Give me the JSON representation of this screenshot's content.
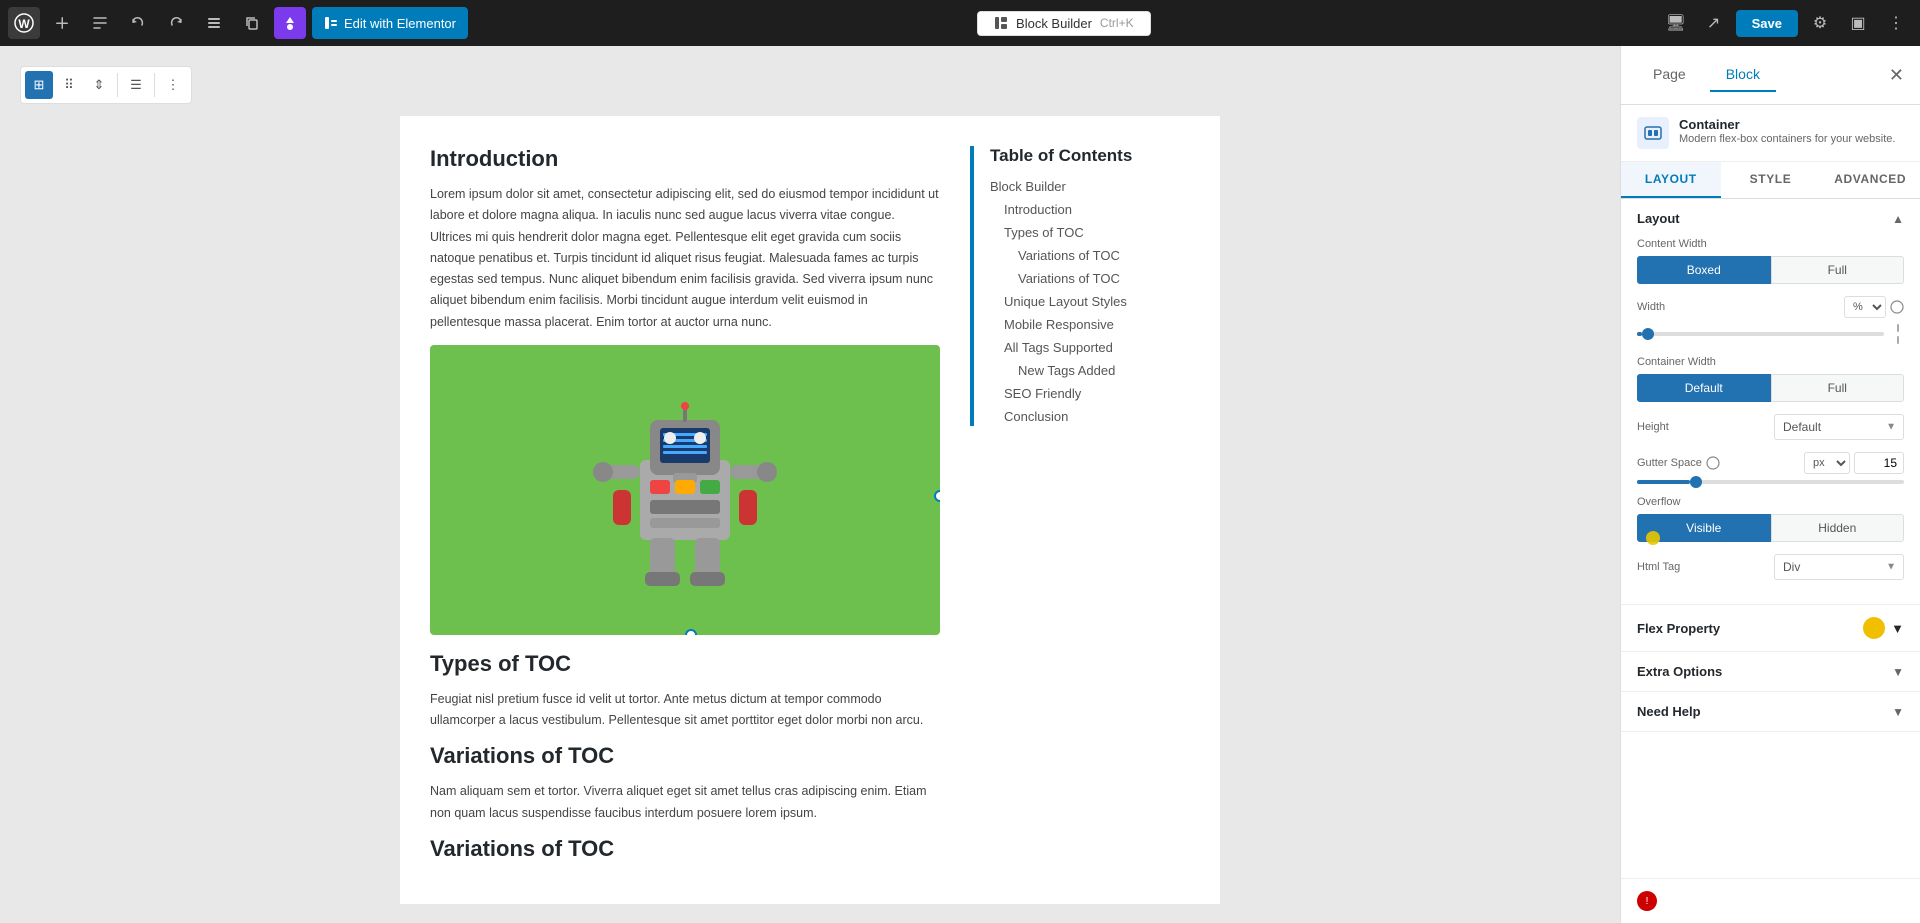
{
  "toolbar": {
    "wp_icon": "W",
    "undo_label": "↩",
    "redo_label": "↪",
    "list_label": "≡",
    "copy_label": "⎘",
    "elementor_label": "Edit with Elementor",
    "block_builder_label": "Block Builder",
    "shortcut": "Ctrl+K",
    "save_label": "Save"
  },
  "block_toolbar": {
    "grid_btn": "⊞",
    "move_btn": "⠿",
    "resize_btn": "⇕",
    "align_btn": "☰",
    "more_btn": "⋮"
  },
  "article": {
    "intro_heading": "Introduction",
    "intro_text": "Lorem ipsum dolor sit amet, consectetur adipiscing elit, sed do eiusmod tempor incididunt ut labore et dolore magna aliqua. In iaculis nunc sed augue lacus viverra vitae congue. Ultrices mi quis hendrerit dolor magna eget. Pellentesque elit eget gravida cum sociis natoque penatibus et. Turpis tincidunt id aliquet risus feugiat. Malesuada fames ac turpis egestas sed tempus. Nunc aliquet bibendum enim facilisis gravida. Sed viverra ipsum nunc aliquet bibendum enim facilisis. Morbi tincidunt augue interdum velit euismod in pellentesque massa placerat. Enim tortor at auctor urna nunc.",
    "types_heading": "Types of TOC",
    "types_text": "Feugiat nisl pretium fusce id velit ut tortor. Ante metus dictum at tempor commodo ullamcorper a lacus vestibulum. Pellentesque sit amet porttitor eget dolor morbi non arcu.",
    "variations_heading": "Variations of TOC",
    "variations_text": "Nam aliquam sem et tortor. Viverra aliquet eget sit amet tellus cras adipiscing enim. Etiam non quam lacus suspendisse faucibus interdum posuere lorem ipsum.",
    "variations2_heading": "Variations of TOC"
  },
  "toc": {
    "title": "Table of Contents",
    "items": [
      {
        "label": "Block Builder",
        "indent": 0
      },
      {
        "label": "Introduction",
        "indent": 1
      },
      {
        "label": "Types of TOC",
        "indent": 1
      },
      {
        "label": "Variations of TOC",
        "indent": 2
      },
      {
        "label": "Variations of TOC",
        "indent": 2
      },
      {
        "label": "Unique Layout Styles",
        "indent": 1
      },
      {
        "label": "Mobile Responsive",
        "indent": 1
      },
      {
        "label": "All Tags Supported",
        "indent": 1
      },
      {
        "label": "New Tags Added",
        "indent": 2
      },
      {
        "label": "SEO Friendly",
        "indent": 1
      },
      {
        "label": "Conclusion",
        "indent": 1
      }
    ]
  },
  "panel": {
    "page_tab": "Page",
    "block_tab": "Block",
    "container_title": "Container",
    "container_desc": "Modern flex-box containers for your website.",
    "layout_tab": "LAYOUT",
    "style_tab": "STYLE",
    "advanced_tab": "ADVANCED",
    "layout_section": {
      "title": "Layout",
      "content_width_label": "Content Width",
      "boxed_btn": "Boxed",
      "full_btn": "Full",
      "width_label": "Width",
      "width_unit": "%",
      "width_value": "",
      "container_width_label": "Container Width",
      "default_btn": "Default",
      "full_btn2": "Full",
      "height_label": "Height",
      "height_value": "Default",
      "gutter_label": "Gutter Space",
      "gutter_unit": "px",
      "gutter_value": "15",
      "overflow_label": "Overflow",
      "visible_btn": "Visible",
      "hidden_btn": "Hidden",
      "html_tag_label": "Html Tag",
      "html_tag_value": "Div"
    },
    "flex_property": {
      "title": "Flex Property"
    },
    "extra_options": {
      "title": "Extra Options"
    },
    "need_help": {
      "title": "Need Help"
    }
  }
}
